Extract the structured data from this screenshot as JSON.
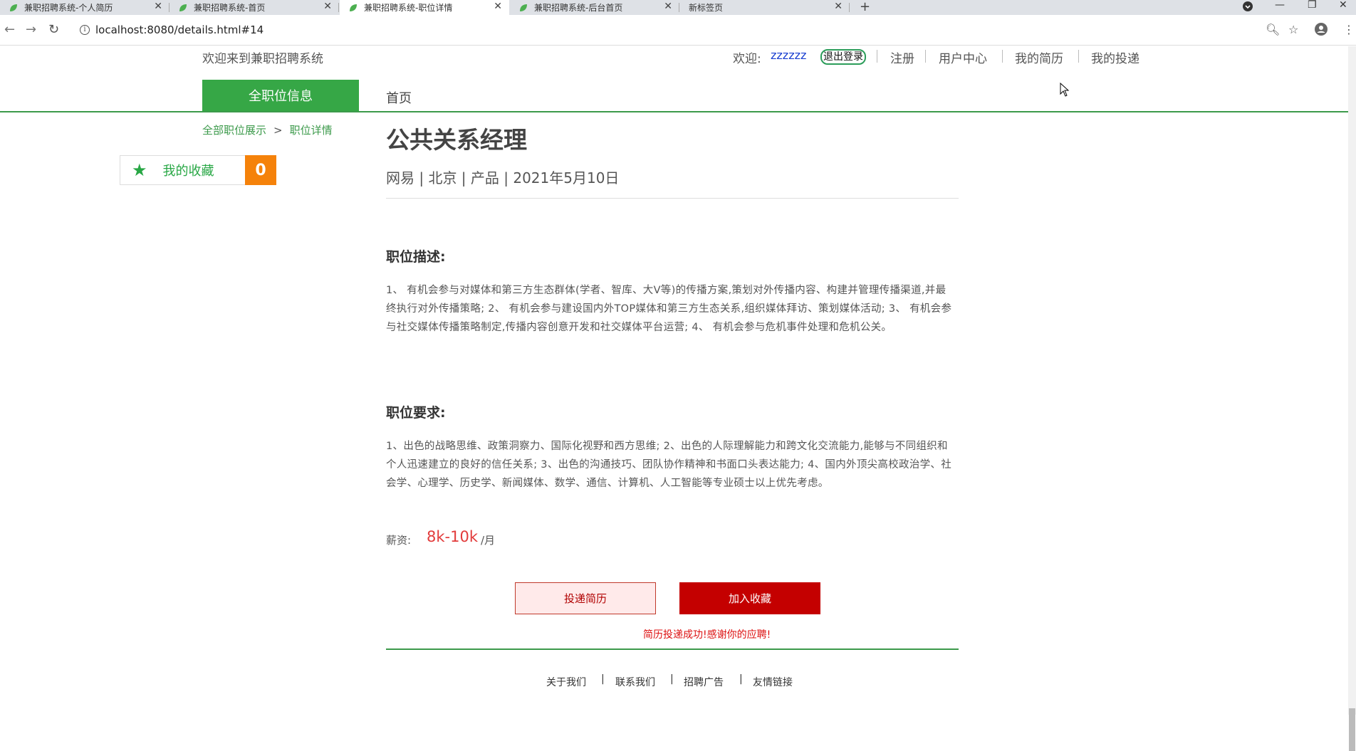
{
  "browser": {
    "tabs": [
      {
        "title": "兼职招聘系统-个人简历"
      },
      {
        "title": "兼职招聘系统-首页"
      },
      {
        "title": "兼职招聘系统-职位详情"
      },
      {
        "title": "兼职招聘系统-后台首页"
      },
      {
        "title": "新标签页"
      }
    ],
    "url": "localhost:8080/details.html#14"
  },
  "header": {
    "welcome": "欢迎来到兼职招聘系统",
    "greeting": "欢迎:",
    "username": "zzzzzz",
    "logout": "退出登录",
    "nav": [
      "注册",
      "用户中心",
      "我的简历",
      "我的投递"
    ]
  },
  "nav": {
    "all_jobs": "全职位信息",
    "home": "首页"
  },
  "breadcrumb": {
    "all": "全部职位展示",
    "sep": ">",
    "current": "职位详情"
  },
  "favorites": {
    "label": "我的收藏",
    "count": "0"
  },
  "job": {
    "title": "公共关系经理",
    "meta": "网易 | 北京 | 产品 | 2021年5月10日",
    "desc_title": "职位描述:",
    "desc": "1、 有机会参与对媒体和第三方生态群体(学者、智库、大V等)的传播方案,策划对外传播内容、构建并管理传播渠道,并最终执行对外传播策略; 2、 有机会参与建设国内外TOP媒体和第三方生态关系,组织媒体拜访、策划媒体活动; 3、 有机会参与社交媒体传播策略制定,传播内容创意开发和社交媒体平台运营; 4、 有机会参与危机事件处理和危机公关。",
    "req_title": "职位要求:",
    "req": "1、出色的战略思维、政策洞察力、国际化视野和西方思维; 2、出色的人际理解能力和跨文化交流能力,能够与不同组织和个人迅速建立的良好的信任关系; 3、出色的沟通技巧、团队协作精神和书面口头表达能力; 4、国内外顶尖高校政治学、社会学、心理学、历史学、新闻媒体、数学、通信、计算机、人工智能等专业硕士以上优先考虑。",
    "salary_label": "薪资:",
    "salary": "8k-10k",
    "salary_unit": "/月",
    "apply_btn": "投递简历",
    "fav_btn": "加入收藏",
    "success_msg": "简历投递成功!感谢你的应聘!"
  },
  "footer": {
    "links": [
      "关于我们",
      "联系我们",
      "招聘广告",
      "友情链接"
    ],
    "sep": "|"
  }
}
